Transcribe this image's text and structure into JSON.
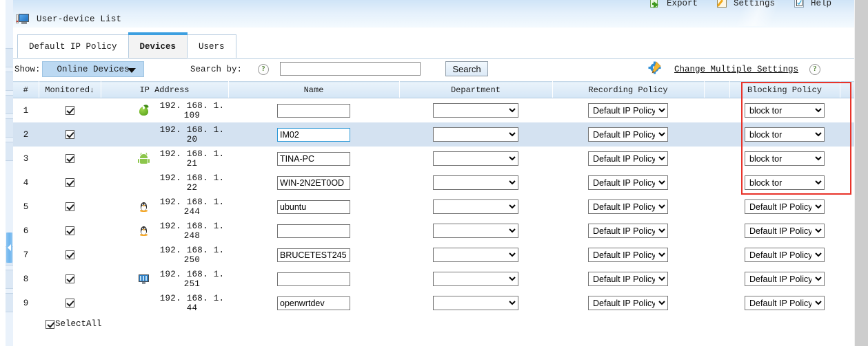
{
  "header": {
    "title": "User-device List",
    "title_icon": "monitor-icon",
    "nav": [
      {
        "label": "Export",
        "icon": "export-icon"
      },
      {
        "label": "Settings",
        "icon": "settings-pencil-icon"
      },
      {
        "label": "Help",
        "icon": "help-check-icon"
      }
    ]
  },
  "tabs": [
    {
      "label": "Default IP Policy",
      "active": false
    },
    {
      "label": "Devices",
      "active": true
    },
    {
      "label": "Users",
      "active": false
    }
  ],
  "filterbar": {
    "show_label": "Show:",
    "show_value": "Online Devices",
    "search_by_label": "Search by:",
    "search_help_icon": "question-mark-icon",
    "search_value": "",
    "search_placeholder": "",
    "search_button": "Search",
    "change_multiple_settings_icon": "gear-pencil-icon",
    "change_multiple_settings": "Change Multiple Settings",
    "cms_help_icon": "question-mark-icon"
  },
  "table": {
    "columns": [
      "#",
      "Monitored",
      "IP Address",
      "Name",
      "Department",
      "Recording Policy",
      "Blocking Policy"
    ],
    "sort_column": "Monitored",
    "sort_arrow": "↓",
    "rows": [
      {
        "index": "1",
        "monitored": true,
        "os": "apple",
        "ip": "192. 168. 1. 109",
        "name": "",
        "department": "",
        "recording_policy": "Default IP Policy",
        "blocking_policy": "block tor",
        "selected": false,
        "name_focused": false
      },
      {
        "index": "2",
        "monitored": true,
        "os": "windows",
        "ip": "192. 168. 1. 20",
        "name": "IM02",
        "department": "",
        "recording_policy": "Default IP Policy",
        "blocking_policy": "block tor",
        "selected": true,
        "name_focused": true
      },
      {
        "index": "3",
        "monitored": true,
        "os": "android",
        "ip": "192. 168. 1. 21",
        "name": "TINA-PC",
        "department": "",
        "recording_policy": "Default IP Policy",
        "blocking_policy": "block tor",
        "selected": false,
        "name_focused": false
      },
      {
        "index": "4",
        "monitored": true,
        "os": "windows",
        "ip": "192. 168. 1. 22",
        "name": "WIN-2N2ET0OD",
        "department": "",
        "recording_policy": "Default IP Policy",
        "blocking_policy": "block tor",
        "selected": false,
        "name_focused": false
      },
      {
        "index": "5",
        "monitored": true,
        "os": "linux",
        "ip": "192. 168. 1. 244",
        "name": "ubuntu",
        "department": "",
        "recording_policy": "Default IP Policy",
        "blocking_policy": "Default IP Policy",
        "selected": false,
        "name_focused": false
      },
      {
        "index": "6",
        "monitored": true,
        "os": "linux",
        "ip": "192. 168. 1. 248",
        "name": "",
        "department": "",
        "recording_policy": "Default IP Policy",
        "blocking_policy": "Default IP Policy",
        "selected": false,
        "name_focused": false
      },
      {
        "index": "7",
        "monitored": true,
        "os": "windows",
        "ip": "192. 168. 1. 250",
        "name": "BRUCETEST245",
        "department": "",
        "recording_policy": "Default IP Policy",
        "blocking_policy": "Default IP Policy",
        "selected": false,
        "name_focused": false
      },
      {
        "index": "8",
        "monitored": true,
        "os": "pc",
        "ip": "192. 168. 1. 251",
        "name": "",
        "department": "",
        "recording_policy": "Default IP Policy",
        "blocking_policy": "Default IP Policy",
        "selected": false,
        "name_focused": false
      },
      {
        "index": "9",
        "monitored": true,
        "os": "windows",
        "ip": "192. 168. 1. 44",
        "name": "openwrtdev",
        "department": "",
        "recording_policy": "Default IP Policy",
        "blocking_policy": "Default IP Policy",
        "selected": false,
        "name_focused": false
      }
    ]
  },
  "footer": {
    "select_all_label": "SelectAll",
    "select_all_checked": true
  },
  "annotation": {
    "type": "rectangle-highlight",
    "color": "#e8332a",
    "target_column": "Blocking Policy"
  },
  "colors": {
    "accent_tab": "#3c9fe0",
    "row_selected": "#d4e2f1",
    "header_grad_top": "#eaf3fb",
    "header_grad_bottom": "#d4e6f6",
    "annotation_red": "#e8332a",
    "dropdown_blue": "#bcd9f2"
  }
}
